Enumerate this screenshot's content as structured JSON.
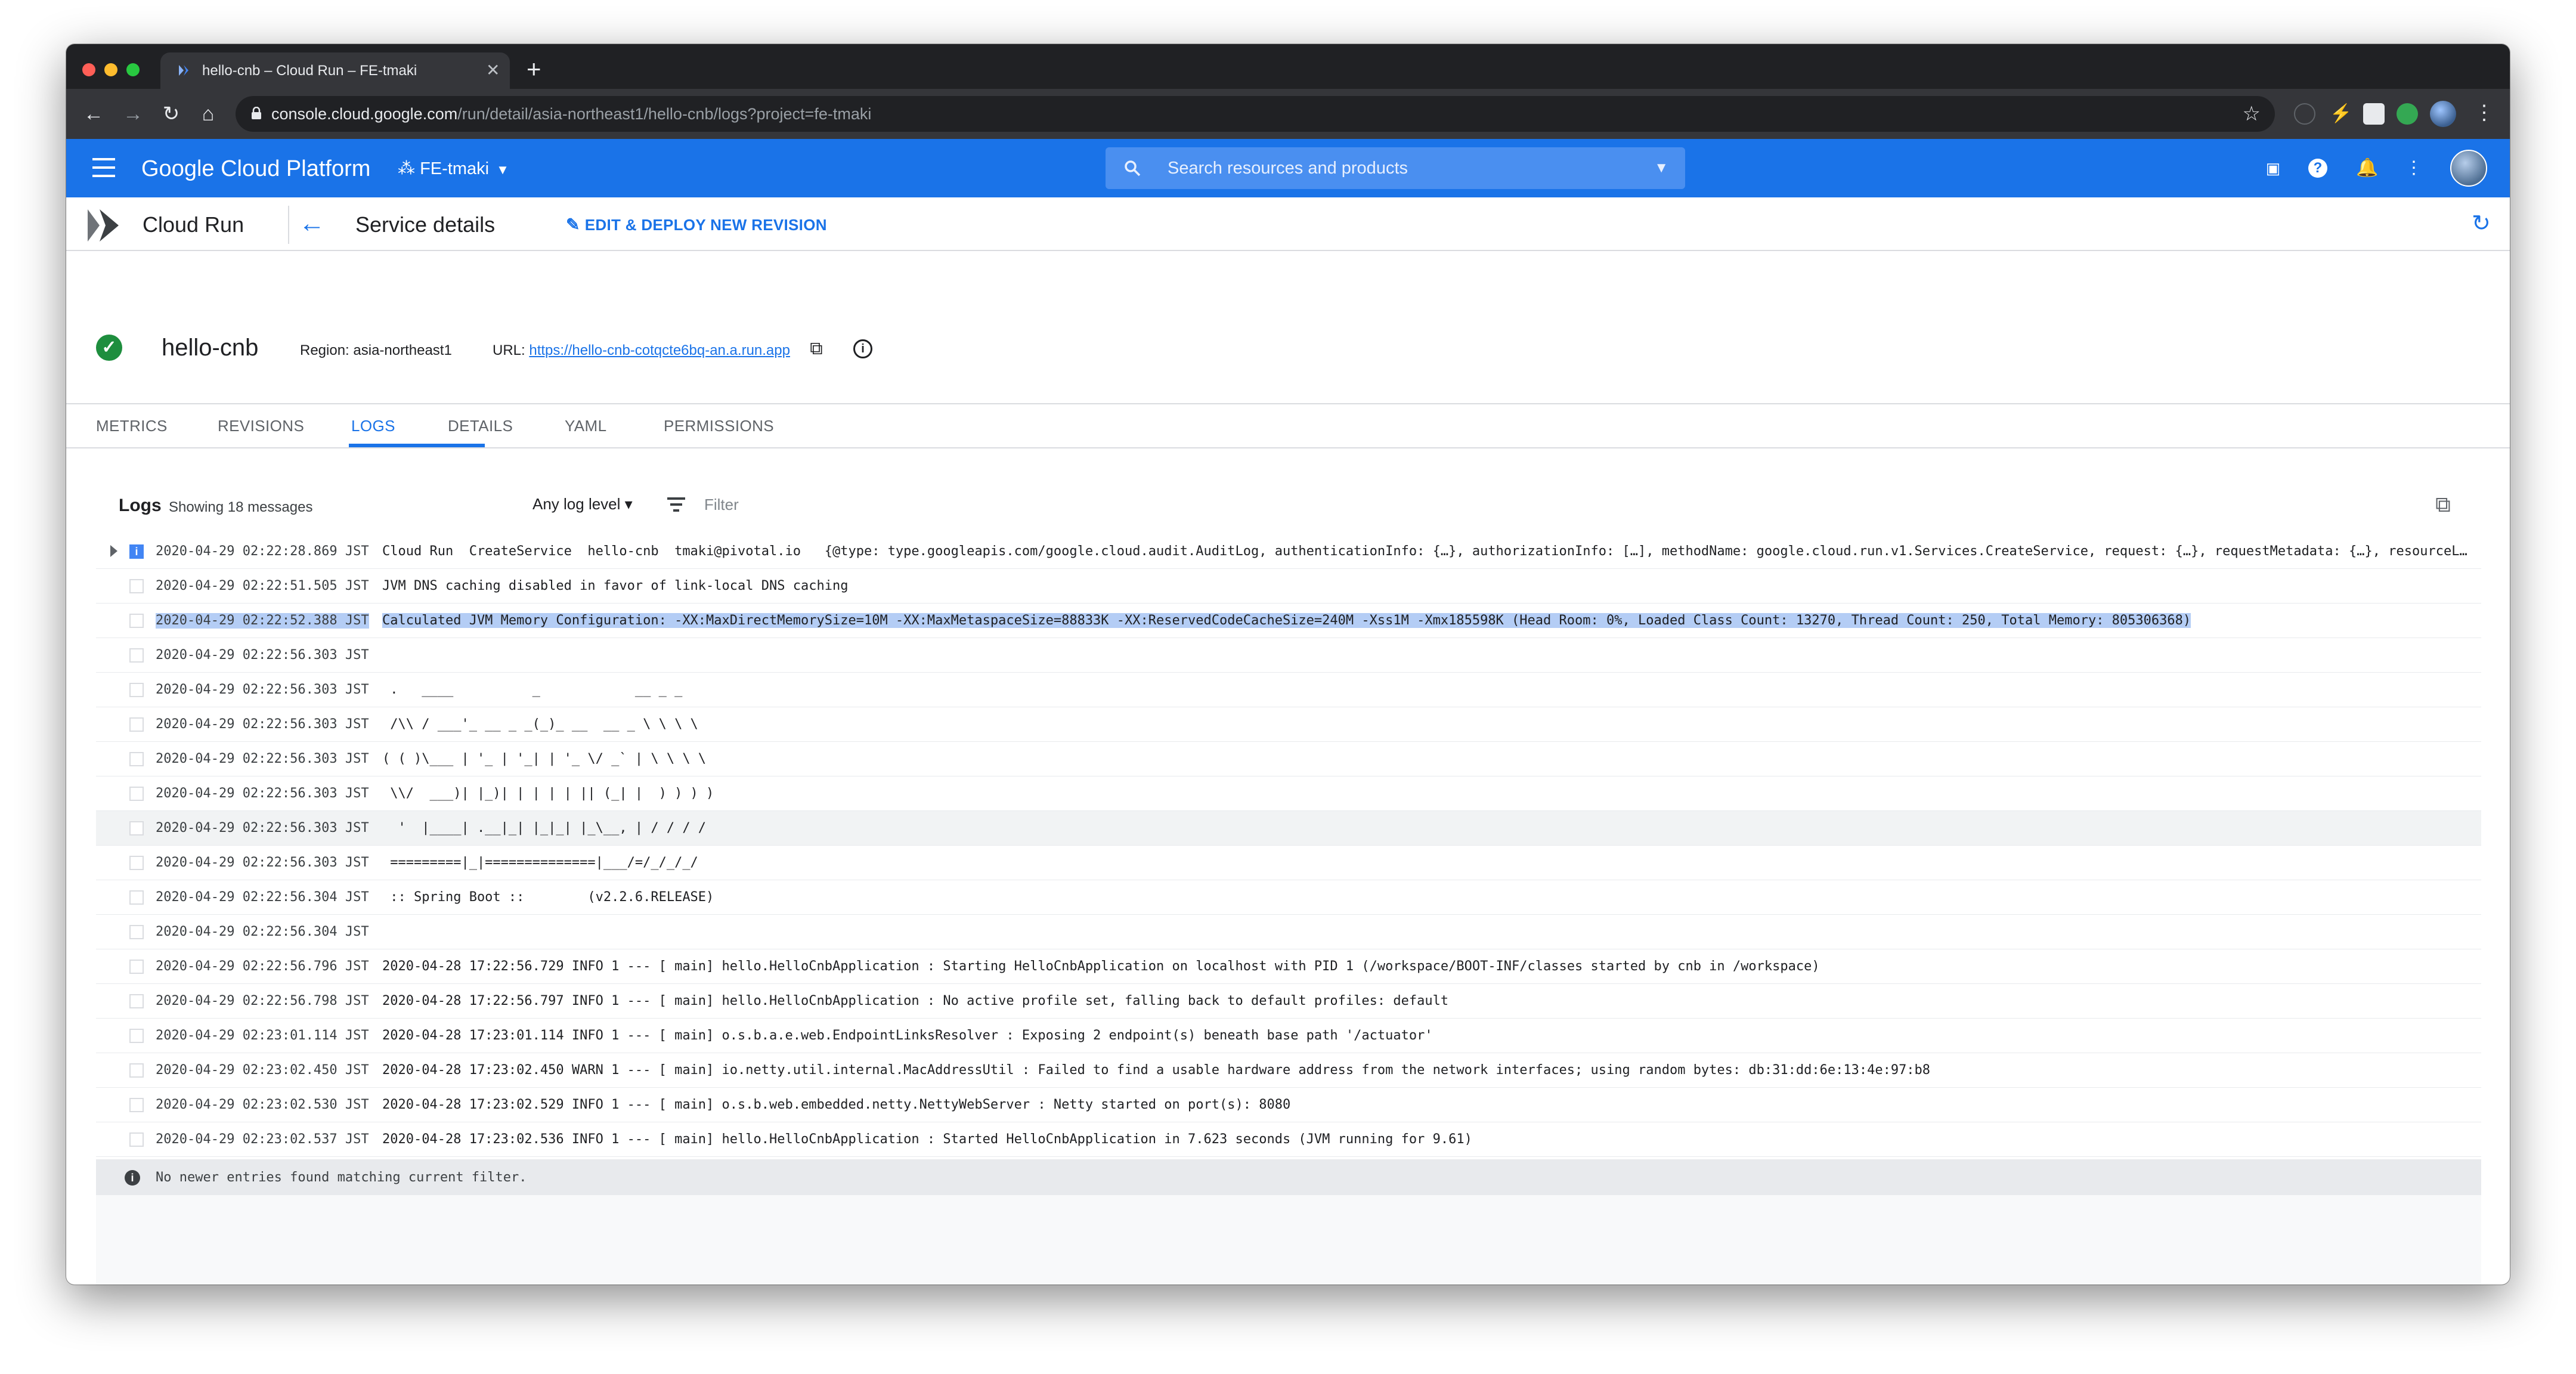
{
  "browser": {
    "tab_title": "hello-cnb – Cloud Run – FE-tmaki",
    "tab_close": "✕",
    "new_tab": "+",
    "url_host": "console.cloud.google.com",
    "url_path": "/run/detail/asia-northeast1/hello-cnb/logs?project=fe-tmaki"
  },
  "gcp_header": {
    "title": "Google Cloud Platform",
    "project": "FE-tmaki",
    "search_placeholder": "Search resources and products"
  },
  "service_bar": {
    "product": "Cloud Run",
    "page_title": "Service details",
    "edit_deploy_label": "EDIT & DEPLOY NEW REVISION"
  },
  "service": {
    "name": "hello-cnb",
    "region_label": "Region: asia-northeast1",
    "url_label": "URL:",
    "url": "https://hello-cnb-cotqcte6bq-an.a.run.app"
  },
  "tabs": [
    {
      "label": "METRICS",
      "active": false
    },
    {
      "label": "REVISIONS",
      "active": false
    },
    {
      "label": "LOGS",
      "active": true
    },
    {
      "label": "DETAILS",
      "active": false
    },
    {
      "label": "YAML",
      "active": false
    },
    {
      "label": "PERMISSIONS",
      "active": false
    }
  ],
  "logs": {
    "title": "Logs",
    "count_text": "Showing 18 messages",
    "log_level": "Any log level",
    "filter_placeholder": "Filter",
    "footer_text": "No newer entries found matching current filter.",
    "rows": [
      {
        "ts": "2020-04-29 02:22:28.869 JST",
        "msg": "Cloud Run  CreateService  hello-cnb  tmaki@pivotal.io   {@type: type.googleapis.com/google.cloud.audit.AuditLog, authenticationInfo: {…}, authorizationInfo: […], methodName: google.cloud.run.v1.Services.CreateService, request: {…}, requestMetadata: {…}, resourceLo…",
        "severity": "info",
        "expandable": true
      },
      {
        "ts": "2020-04-29 02:22:51.505 JST",
        "msg": "JVM DNS caching disabled in favor of link-local DNS caching"
      },
      {
        "ts": "2020-04-29 02:22:52.388 JST",
        "msg": "Calculated JVM Memory Configuration: -XX:MaxDirectMemorySize=10M -XX:MaxMetaspaceSize=88833K -XX:ReservedCodeCacheSize=240M -Xss1M -Xmx185598K (Head Room: 0%, Loaded Class Count: 13270, Thread Count: 250, Total Memory: 805306368)",
        "selected": true
      },
      {
        "ts": "2020-04-29 02:22:56.303 JST",
        "msg": ""
      },
      {
        "ts": "2020-04-29 02:22:56.303 JST",
        "msg": " .   ____          _            __ _ _"
      },
      {
        "ts": "2020-04-29 02:22:56.303 JST",
        "msg": " /\\\\ / ___'_ __ _ _(_)_ __  __ _ \\ \\ \\ \\"
      },
      {
        "ts": "2020-04-29 02:22:56.303 JST",
        "msg": "( ( )\\___ | '_ | '_| | '_ \\/ _` | \\ \\ \\ \\"
      },
      {
        "ts": "2020-04-29 02:22:56.303 JST",
        "msg": " \\\\/  ___)| |_)| | | | | || (_| |  ) ) ) )"
      },
      {
        "ts": "2020-04-29 02:22:56.303 JST",
        "msg": "  '  |____| .__|_| |_|_| |_\\__, | / / / /",
        "highlight": true
      },
      {
        "ts": "2020-04-29 02:22:56.303 JST",
        "msg": " =========|_|==============|___/=/_/_/_/"
      },
      {
        "ts": "2020-04-29 02:22:56.304 JST",
        "msg": " :: Spring Boot ::        (v2.2.6.RELEASE)"
      },
      {
        "ts": "2020-04-29 02:22:56.304 JST",
        "msg": ""
      },
      {
        "ts": "2020-04-29 02:22:56.796 JST",
        "msg": "2020-04-28 17:22:56.729 INFO 1 --- [ main] hello.HelloCnbApplication : Starting HelloCnbApplication on localhost with PID 1 (/workspace/BOOT-INF/classes started by cnb in /workspace)"
      },
      {
        "ts": "2020-04-29 02:22:56.798 JST",
        "msg": "2020-04-28 17:22:56.797 INFO 1 --- [ main] hello.HelloCnbApplication : No active profile set, falling back to default profiles: default"
      },
      {
        "ts": "2020-04-29 02:23:01.114 JST",
        "msg": "2020-04-28 17:23:01.114 INFO 1 --- [ main] o.s.b.a.e.web.EndpointLinksResolver : Exposing 2 endpoint(s) beneath base path '/actuator'"
      },
      {
        "ts": "2020-04-29 02:23:02.450 JST",
        "msg": "2020-04-28 17:23:02.450 WARN 1 --- [ main] io.netty.util.internal.MacAddressUtil : Failed to find a usable hardware address from the network interfaces; using random bytes: db:31:dd:6e:13:4e:97:b8"
      },
      {
        "ts": "2020-04-29 02:23:02.530 JST",
        "msg": "2020-04-28 17:23:02.529 INFO 1 --- [ main] o.s.b.web.embedded.netty.NettyWebServer : Netty started on port(s): 8080"
      },
      {
        "ts": "2020-04-29 02:23:02.537 JST",
        "msg": "2020-04-28 17:23:02.536 INFO 1 --- [ main] hello.HelloCnbApplication : Started HelloCnbApplication in 7.623 seconds (JVM running for 9.61)"
      }
    ]
  },
  "colors": {
    "gcp_blue": "#1a73e8",
    "success_green": "#1e8e3e",
    "selection": "#b4cdf5"
  }
}
